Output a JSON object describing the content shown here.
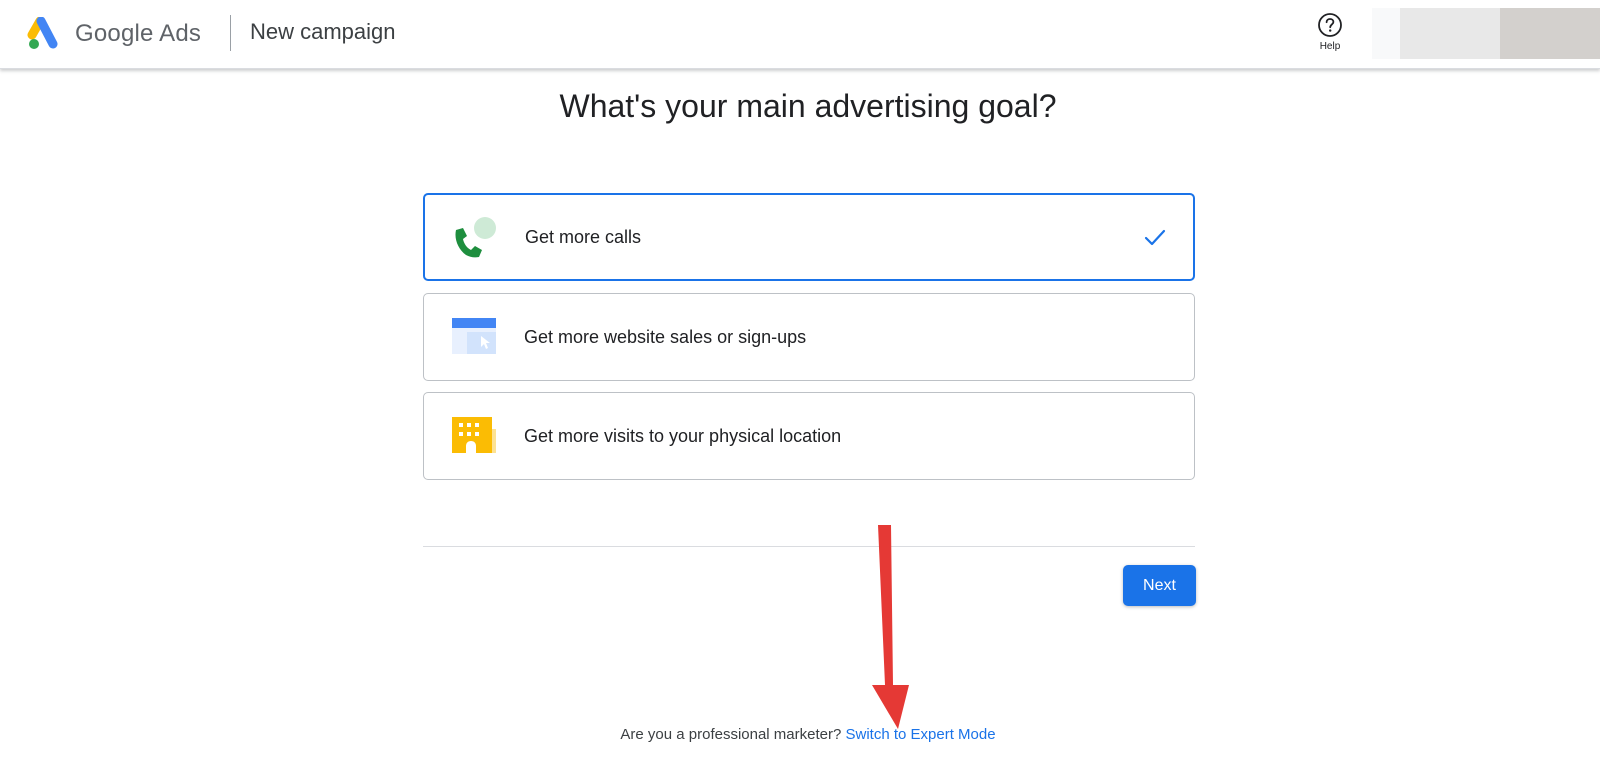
{
  "header": {
    "brand_name": "Google Ads",
    "page_name": "New campaign",
    "help_label": "Help"
  },
  "main": {
    "heading": "What's your main advertising goal?",
    "goals": [
      {
        "label": "Get more calls",
        "icon": "phone-chat-icon",
        "selected": true
      },
      {
        "label": "Get more website sales or sign-ups",
        "icon": "website-cursor-icon",
        "selected": false
      },
      {
        "label": "Get more visits to your physical location",
        "icon": "storefront-icon",
        "selected": false
      }
    ],
    "next_label": "Next"
  },
  "footer": {
    "prompt": "Are you a professional marketer?",
    "expert_link": "Switch to Expert Mode"
  },
  "colors": {
    "accent": "#1a73e8",
    "annotation_arrow": "#e53935"
  }
}
